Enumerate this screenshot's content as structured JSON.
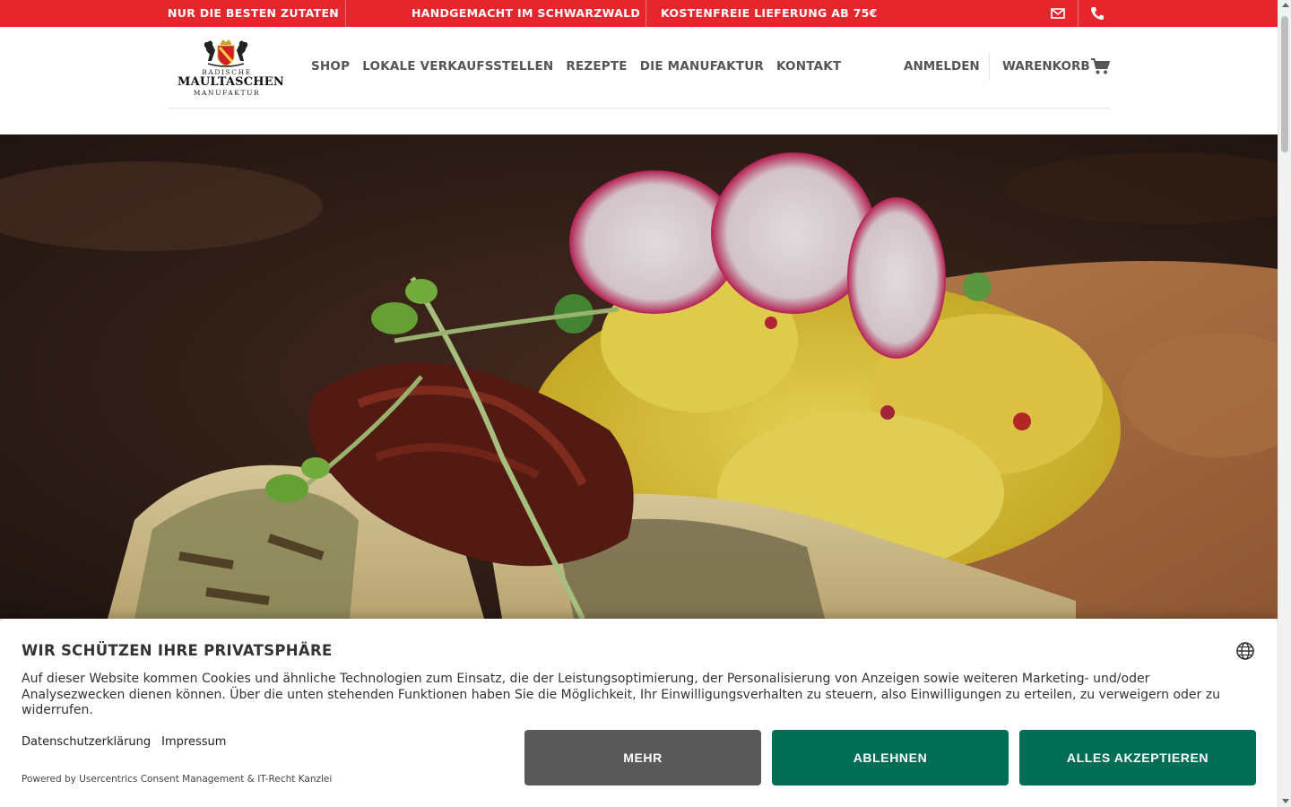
{
  "topbar": {
    "items": [
      "NUR DIE BESTEN ZUTATEN",
      "HANDGEMACHT IM SCHWARZWALD",
      "KOSTENFREIE LIEFERUNG AB 75€"
    ],
    "icons": [
      "mail-icon",
      "phone-icon"
    ],
    "color": "#e5262c"
  },
  "logo": {
    "line1": "BADISCHE",
    "line2": "MAULTASCHEN",
    "line3": "MANUFAKTUR"
  },
  "nav": {
    "items": [
      "SHOP",
      "LOKALE VERKAUFSSTELLEN",
      "REZEPTE",
      "DIE MANUFAKTUR",
      "KONTAKT"
    ]
  },
  "header": {
    "login": "ANMELDEN",
    "cart": "WARENKORB",
    "cart_icon": "cart-icon"
  },
  "consent": {
    "title": "WIR SCHÜTZEN IHRE PRIVATSPHÄRE",
    "text": "Auf dieser Website kommen Cookies und ähnliche Technologien zum Einsatz, die der Leistungsoptimierung, der Personalisierung von Anzeigen sowie weiteren Marketing- und/oder Analysezwecken dienen können. Über die unten stehenden Funktionen haben Sie die Möglichkeit, Ihr Einwilligungsverhalten zu steuern, also Einwilligungen zu erteilen, zu verweigern oder zu widerrufen.",
    "links": [
      "Datenschutzerklärung",
      "Impressum"
    ],
    "powered": "Powered by Usercentrics Consent Management & IT-Recht Kanzlei",
    "buttons": {
      "more": "MEHR",
      "deny": "ABLEHNEN",
      "accept": "ALLES AKZEPTIEREN"
    },
    "accent": "#006d55",
    "language_icon": "globe-icon"
  }
}
